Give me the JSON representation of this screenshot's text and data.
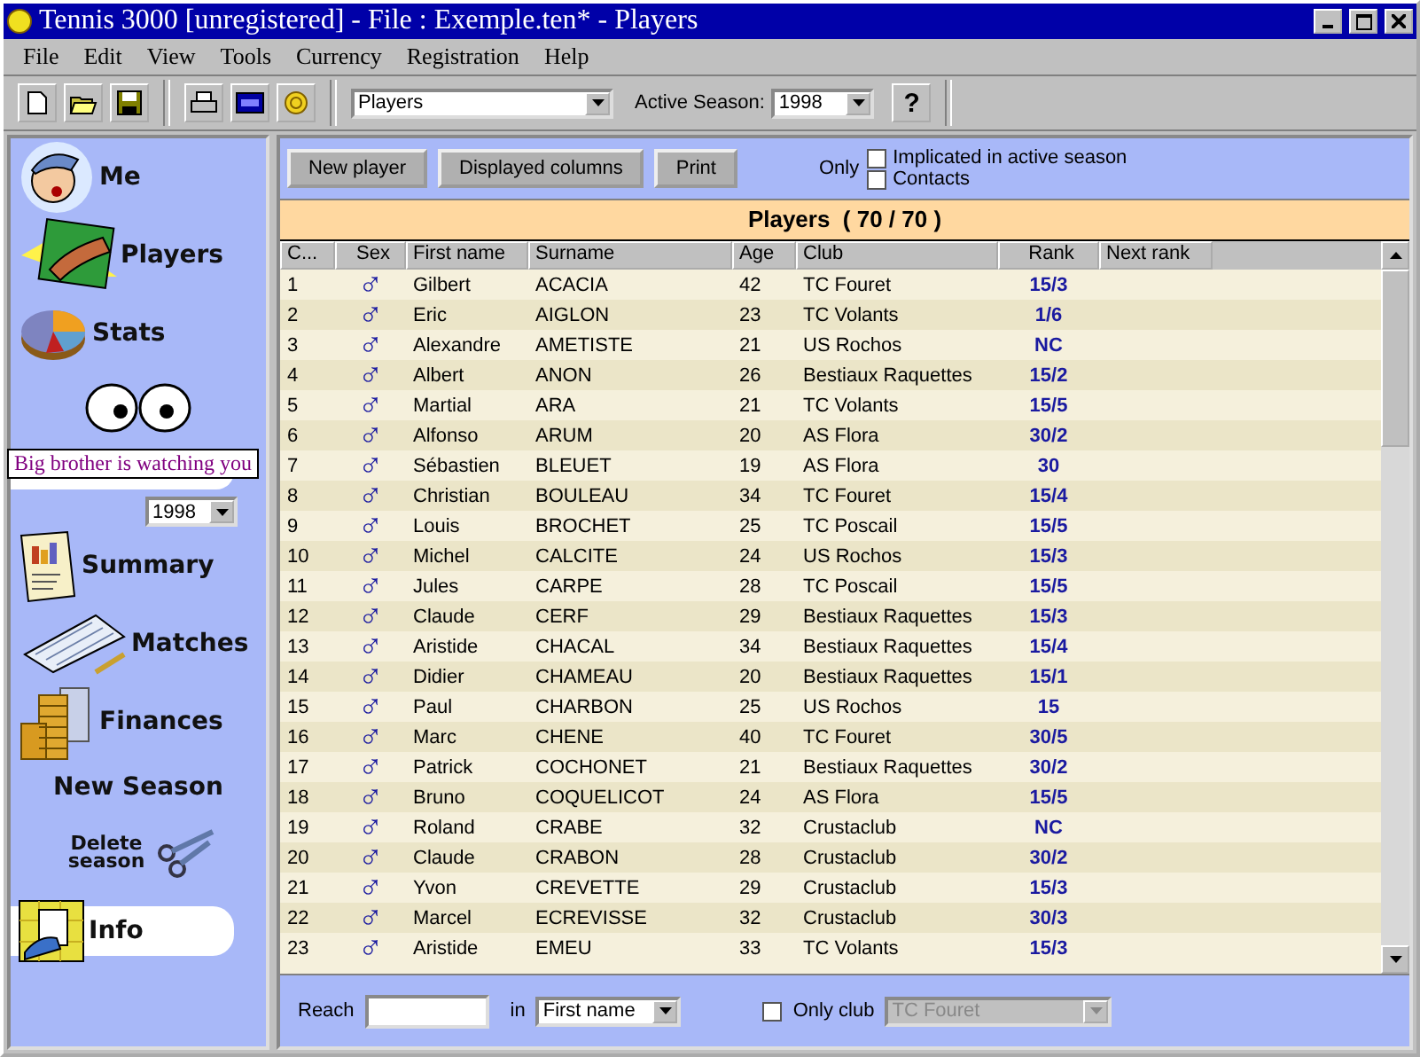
{
  "window": {
    "title": "Tennis 3000 [unregistered] - File : Exemple.ten* - Players"
  },
  "menu": [
    "File",
    "Edit",
    "View",
    "Tools",
    "Currency",
    "Registration",
    "Help"
  ],
  "toolbar": {
    "view_select": "Players",
    "season_label": "Active Season:",
    "season_select": "1998",
    "help_button": "?"
  },
  "sidebar": {
    "items": [
      {
        "label": "Me",
        "selected": false
      },
      {
        "label": "Players",
        "selected": false
      },
      {
        "label": "Stats",
        "selected": false
      },
      {
        "label": "Summary",
        "selected": false
      },
      {
        "label": "Matches",
        "selected": false
      },
      {
        "label": "Finances",
        "selected": false
      },
      {
        "label": "New Season",
        "selected": false
      },
      {
        "label": "Delete season",
        "selected": false
      },
      {
        "label": "Info",
        "selected": true
      }
    ],
    "tooltip": "Big brother is watching you",
    "season_select": "1998"
  },
  "actions": [
    "New player",
    "Displayed columns",
    "Print"
  ],
  "filters": {
    "label": "Only",
    "options": [
      {
        "label": "Implicated in active season",
        "checked": false
      },
      {
        "label": "Contacts",
        "checked": false
      }
    ]
  },
  "table": {
    "title": "Players  ( 70 / 70 )",
    "columns": [
      "C...",
      "Sex",
      "First name",
      "Surname",
      "Age",
      "Club",
      "Rank",
      "Next rank"
    ],
    "rows": [
      {
        "n": "1",
        "sex": "♂",
        "first": "Gilbert",
        "surname": "ACACIA",
        "age": "42",
        "club": "TC Fouret",
        "rank": "15/3"
      },
      {
        "n": "2",
        "sex": "♂",
        "first": "Eric",
        "surname": "AIGLON",
        "age": "23",
        "club": "TC Volants",
        "rank": "1/6"
      },
      {
        "n": "3",
        "sex": "♂",
        "first": "Alexandre",
        "surname": "AMETISTE",
        "age": "21",
        "club": "US Rochos",
        "rank": "NC"
      },
      {
        "n": "4",
        "sex": "♂",
        "first": "Albert",
        "surname": "ANON",
        "age": "26",
        "club": "Bestiaux Raquettes",
        "rank": "15/2"
      },
      {
        "n": "5",
        "sex": "♂",
        "first": "Martial",
        "surname": "ARA",
        "age": "21",
        "club": "TC Volants",
        "rank": "15/5"
      },
      {
        "n": "6",
        "sex": "♂",
        "first": "Alfonso",
        "surname": "ARUM",
        "age": "20",
        "club": "AS Flora",
        "rank": "30/2"
      },
      {
        "n": "7",
        "sex": "♂",
        "first": "Sébastien",
        "surname": "BLEUET",
        "age": "19",
        "club": "AS Flora",
        "rank": "30"
      },
      {
        "n": "8",
        "sex": "♂",
        "first": "Christian",
        "surname": "BOULEAU",
        "age": "34",
        "club": "TC Fouret",
        "rank": "15/4"
      },
      {
        "n": "9",
        "sex": "♂",
        "first": "Louis",
        "surname": "BROCHET",
        "age": "25",
        "club": "TC Poscail",
        "rank": "15/5"
      },
      {
        "n": "10",
        "sex": "♂",
        "first": "Michel",
        "surname": "CALCITE",
        "age": "24",
        "club": "US Rochos",
        "rank": "15/3"
      },
      {
        "n": "11",
        "sex": "♂",
        "first": "Jules",
        "surname": "CARPE",
        "age": "28",
        "club": "TC Poscail",
        "rank": "15/5"
      },
      {
        "n": "12",
        "sex": "♂",
        "first": "Claude",
        "surname": "CERF",
        "age": "29",
        "club": "Bestiaux Raquettes",
        "rank": "15/3"
      },
      {
        "n": "13",
        "sex": "♂",
        "first": "Aristide",
        "surname": "CHACAL",
        "age": "34",
        "club": "Bestiaux Raquettes",
        "rank": "15/4"
      },
      {
        "n": "14",
        "sex": "♂",
        "first": "Didier",
        "surname": "CHAMEAU",
        "age": "20",
        "club": "Bestiaux Raquettes",
        "rank": "15/1"
      },
      {
        "n": "15",
        "sex": "♂",
        "first": "Paul",
        "surname": "CHARBON",
        "age": "25",
        "club": "US Rochos",
        "rank": "15"
      },
      {
        "n": "16",
        "sex": "♂",
        "first": "Marc",
        "surname": "CHENE",
        "age": "40",
        "club": "TC Fouret",
        "rank": "30/5"
      },
      {
        "n": "17",
        "sex": "♂",
        "first": "Patrick",
        "surname": "COCHONET",
        "age": "21",
        "club": "Bestiaux Raquettes",
        "rank": "30/2"
      },
      {
        "n": "18",
        "sex": "♂",
        "first": "Bruno",
        "surname": "COQUELICOT",
        "age": "24",
        "club": "AS Flora",
        "rank": "15/5"
      },
      {
        "n": "19",
        "sex": "♂",
        "first": "Roland",
        "surname": "CRABE",
        "age": "32",
        "club": "Crustaclub",
        "rank": "NC"
      },
      {
        "n": "20",
        "sex": "♂",
        "first": "Claude",
        "surname": "CRABON",
        "age": "28",
        "club": "Crustaclub",
        "rank": "30/2"
      },
      {
        "n": "21",
        "sex": "♂",
        "first": "Yvon",
        "surname": "CREVETTE",
        "age": "29",
        "club": "Crustaclub",
        "rank": "15/3"
      },
      {
        "n": "22",
        "sex": "♂",
        "first": "Marcel",
        "surname": "ECREVISSE",
        "age": "32",
        "club": "Crustaclub",
        "rank": "30/3"
      },
      {
        "n": "23",
        "sex": "♂",
        "first": "Aristide",
        "surname": "EMEU",
        "age": "33",
        "club": "TC Volants",
        "rank": "15/3"
      }
    ]
  },
  "search": {
    "label": "Reach",
    "in_label": "in",
    "field_select": "First name",
    "only_club": {
      "label": "Only club",
      "checked": false
    },
    "club_select": "TC Fouret"
  }
}
